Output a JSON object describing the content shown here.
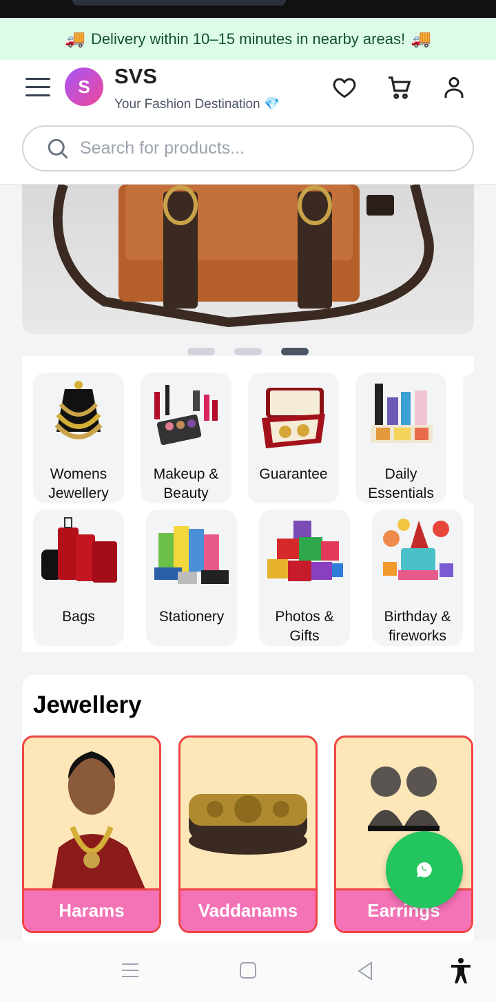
{
  "delivery_banner": {
    "text": "Delivery within 10–15 minutes in nearby areas!",
    "icon": "truck-icon"
  },
  "header": {
    "logo_letter": "S",
    "brand_name": "SVS",
    "tagline": "Your Fashion Destination 💎",
    "icons": [
      "menu-icon",
      "heart-icon",
      "cart-icon",
      "user-icon"
    ]
  },
  "search": {
    "placeholder": "Search for products..."
  },
  "carousel": {
    "slides": 3,
    "active_index": 2
  },
  "categories": {
    "row1": [
      {
        "label": "Womens Jewellery"
      },
      {
        "label": "Makeup & Beauty"
      },
      {
        "label": "Guarantee"
      },
      {
        "label": "Daily Essentials"
      }
    ],
    "row2": [
      {
        "label": "Bags"
      },
      {
        "label": "Stationery"
      },
      {
        "label": "Photos & Gifts"
      },
      {
        "label": "Birthday & fireworks"
      }
    ]
  },
  "jewellery_section": {
    "title": "Jewellery",
    "cards": [
      {
        "label": "Harams"
      },
      {
        "label": "Vaddanams"
      },
      {
        "label": "Earrings"
      }
    ]
  },
  "colors": {
    "accent_pink": "#f472b6",
    "card_border": "#ef4444",
    "whatsapp": "#22c55e",
    "delivery_bg": "#dcfce7"
  }
}
